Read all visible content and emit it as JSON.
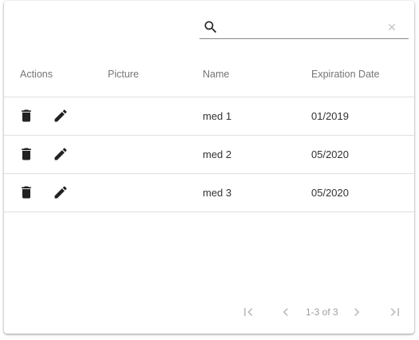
{
  "search": {
    "value": "",
    "placeholder": "",
    "icon": "search-icon",
    "clear_icon": "close-icon"
  },
  "table": {
    "headers": {
      "actions": "Actions",
      "picture": "Picture",
      "name": "Name",
      "expiration": "Expiration Date"
    },
    "rows": [
      {
        "name": "med 1",
        "expiration": "01/2019",
        "picture": ""
      },
      {
        "name": "med 2",
        "expiration": "05/2020",
        "picture": ""
      },
      {
        "name": "med 3",
        "expiration": "05/2020",
        "picture": ""
      }
    ],
    "row_actions": [
      "delete-icon",
      "edit-icon"
    ]
  },
  "pagination": {
    "range_text": "1-3 of 3",
    "icons": [
      "first-page-icon",
      "previous-page-icon",
      "next-page-icon",
      "last-page-icon"
    ]
  },
  "colors": {
    "icon_dark": "#212121",
    "icon_muted": "#bdbdbd",
    "header_text": "#757575",
    "divider": "#e0e0e0"
  }
}
